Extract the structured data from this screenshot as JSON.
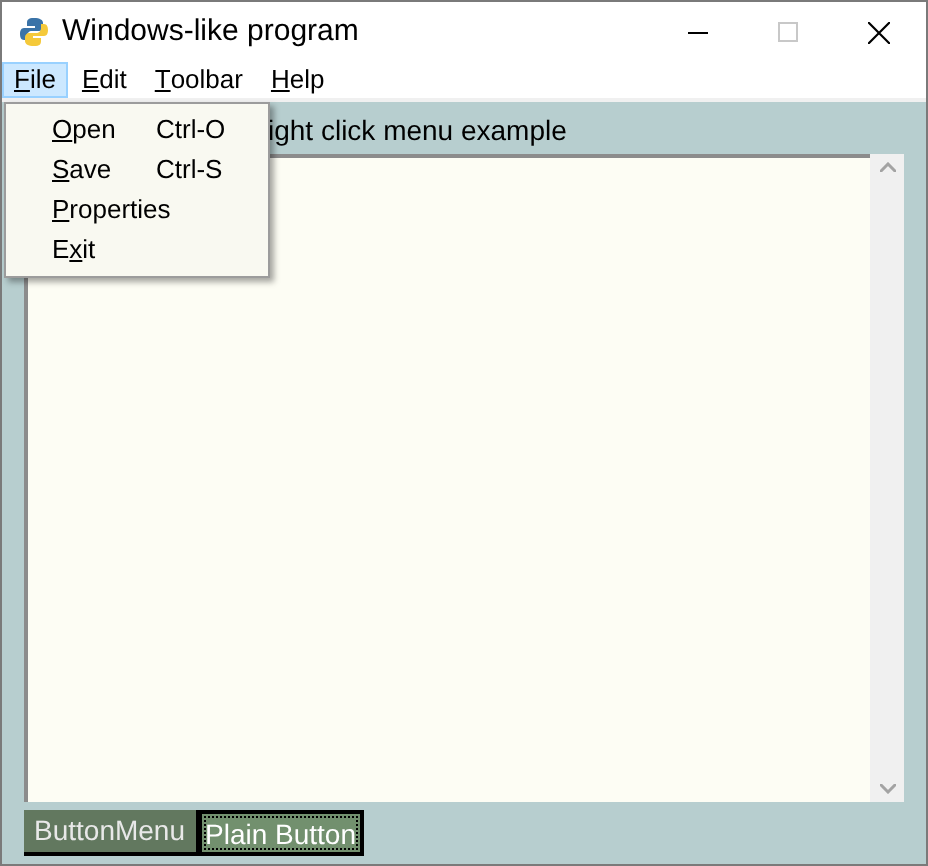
{
  "window": {
    "title": "Windows-like program"
  },
  "menubar": [
    {
      "key": "F",
      "after": "ile",
      "selected": true
    },
    {
      "key": "E",
      "after": "dit",
      "selected": false
    },
    {
      "key": "T",
      "after": "oolbar",
      "selected": false
    },
    {
      "key": "H",
      "after": "elp",
      "selected": false
    }
  ],
  "menu": [
    {
      "key": "O",
      "after": "pen",
      "shortcut": "Ctrl-O"
    },
    {
      "key": "S",
      "after": "ave",
      "shortcut": "Ctrl-S"
    },
    {
      "key": "P",
      "after": "roperties"
    },
    {
      "before": "E",
      "key": "x",
      "after": "it"
    }
  ],
  "label": "ight click menu example",
  "buttons": [
    {
      "label": "ButtonMenu",
      "focused": false
    },
    {
      "label": "Plain Button",
      "focused": true
    }
  ]
}
